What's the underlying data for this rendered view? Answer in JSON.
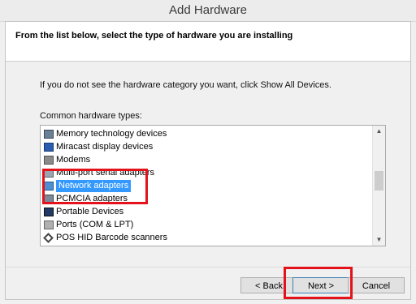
{
  "window": {
    "title": "Add Hardware"
  },
  "header": {
    "instruction": "From the list below, select the type of hardware you are installing"
  },
  "body": {
    "hint": "If you do not see the hardware category you want, click Show All Devices.",
    "list_label": "Common hardware types:"
  },
  "list": {
    "items": [
      {
        "label": "Memory technology devices",
        "icon": "memory-icon"
      },
      {
        "label": "Miracast display devices",
        "icon": "display-icon"
      },
      {
        "label": "Modems",
        "icon": "modem-icon"
      },
      {
        "label": "Multi-port serial adapters",
        "icon": "serial-adapter-icon"
      },
      {
        "label": "Network adapters",
        "icon": "network-adapter-icon",
        "selected": true
      },
      {
        "label": "PCMCIA adapters",
        "icon": "pcmcia-icon"
      },
      {
        "label": "Portable Devices",
        "icon": "portable-device-icon"
      },
      {
        "label": "Ports (COM & LPT)",
        "icon": "ports-icon"
      },
      {
        "label": "POS HID Barcode scanners",
        "icon": "barcode-scanner-icon"
      }
    ]
  },
  "buttons": {
    "back": "< Back",
    "next": "Next >",
    "cancel": "Cancel"
  },
  "colors": {
    "selection": "#3399ff",
    "highlight_box": "#e3121b"
  }
}
